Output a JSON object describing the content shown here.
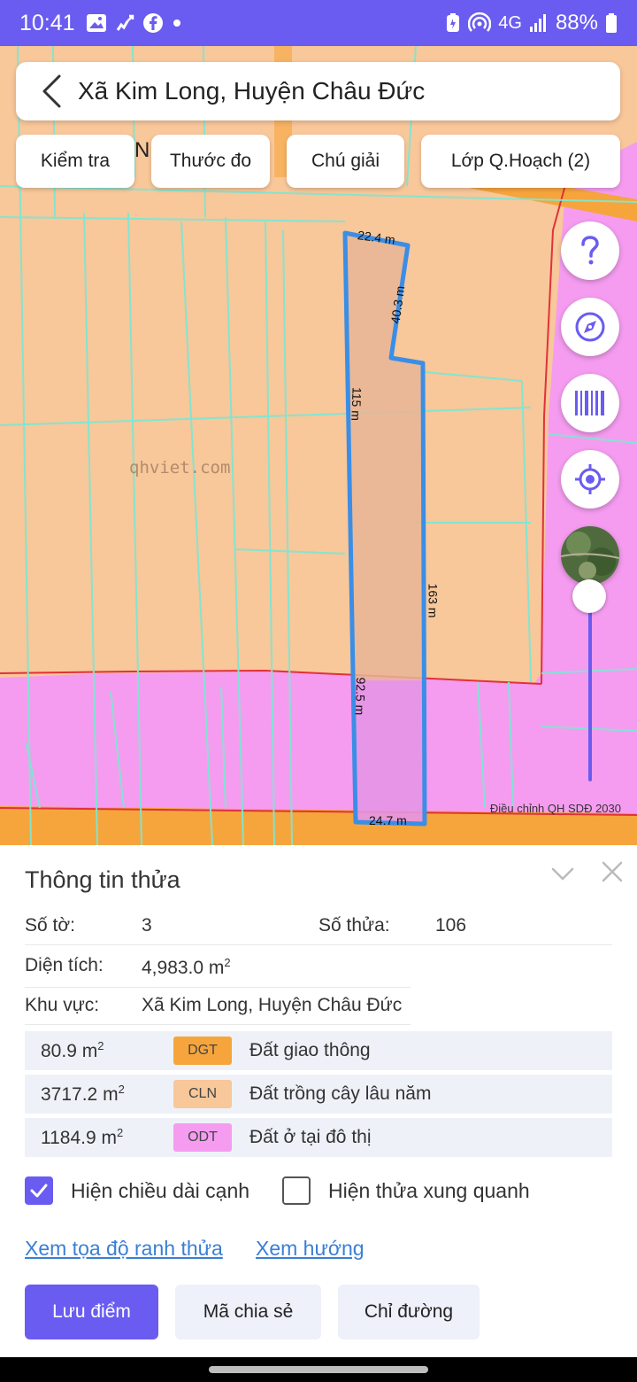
{
  "status_bar": {
    "time": "10:41",
    "network": "4G",
    "battery": "88%",
    "icons": [
      "image-icon",
      "missed-call-icon",
      "facebook-icon",
      "dot-icon",
      "battery-saver-icon",
      "hotspot-icon",
      "signal-icon",
      "battery-icon"
    ]
  },
  "header": {
    "title": "Xã Kim Long, Huyện Châu Đức"
  },
  "chips": [
    {
      "label": "Kiểm tra"
    },
    {
      "label": "Thước đo"
    },
    {
      "label": "Chú giải"
    },
    {
      "label": "Lớp Q.Hoạch (2)"
    }
  ],
  "map": {
    "watermark": "qhviet.com",
    "attribution": "Điều chỉnh QH SDĐ 2030",
    "hidden_label": "N",
    "edge_lengths": {
      "top": "22.4 m",
      "upper_right": "40.3 m",
      "left_upper": "115 m",
      "right": "163 m",
      "left_lower": "92.5 m",
      "bottom": "24.7 m"
    },
    "colors": {
      "cln": "#f8c79a",
      "odt": "#f59cf0",
      "dgt": "#f6a53c",
      "boundary": "#3a8ee6",
      "grid": "#7fe6d2"
    }
  },
  "side_buttons": [
    "help-icon",
    "compass-icon",
    "barcode-icon",
    "locate-icon",
    "satellite-layer-icon"
  ],
  "sheet": {
    "title": "Thông tin thửa",
    "so_to_label": "Số tờ:",
    "so_to_value": "3",
    "so_thua_label": "Số thửa:",
    "so_thua_value": "106",
    "dien_tich_label": "Diện tích:",
    "dien_tich_value": "4,983.0 m",
    "area_unit_sup": "2",
    "khu_vuc_label": "Khu vực:",
    "khu_vuc_value": "Xã Kim Long, Huyện Châu Đức",
    "land_uses": [
      {
        "area": "80.9 m",
        "sup": "2",
        "code": "DGT",
        "name": "Đất giao thông",
        "color": "#f6a53c"
      },
      {
        "area": "3717.2 m",
        "sup": "2",
        "code": "CLN",
        "name": "Đất trồng cây lâu năm",
        "color": "#f8c79a"
      },
      {
        "area": "1184.9 m",
        "sup": "2",
        "code": "ODT",
        "name": "Đất ở tại đô thị",
        "color": "#f59cf0"
      }
    ],
    "show_edges_label": "Hiện chiều dài cạnh",
    "show_neighbors_label": "Hiện thửa xung quanh",
    "link_coords": "Xem tọa độ ranh thửa",
    "link_direction": "Xem hướng",
    "btn_save": "Lưu điểm",
    "btn_share": "Mã chia sẻ",
    "btn_route": "Chỉ đường"
  },
  "accent_color": "#6a5cf0"
}
